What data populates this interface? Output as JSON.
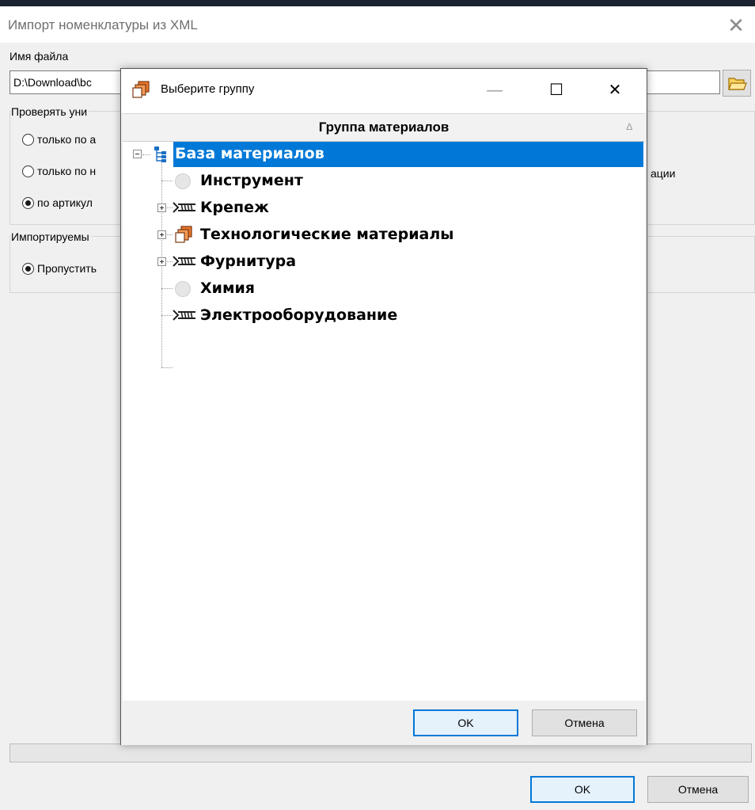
{
  "main": {
    "title": "Импорт номенклатуры из XML",
    "filename_label": "Имя файла",
    "filename_value": "D:\\Download\\bc",
    "check_group_label": "Проверять уни",
    "radio_options": [
      {
        "label": "только по а",
        "checked": false
      },
      {
        "label": "только по н",
        "checked": false
      },
      {
        "label": "по артикул",
        "checked": true
      }
    ],
    "right_fragment": "ации",
    "import_group_label": "Импортируемы",
    "skip_option": {
      "label": "Пропустить",
      "checked": true
    },
    "ok_label": "OK",
    "cancel_label": "Отмена"
  },
  "dialog": {
    "title": "Выберите группу",
    "column_header": "Группа материалов",
    "sort_indicator": "∆",
    "tree": [
      {
        "label": "База материалов",
        "icon": "hierarchy-icon",
        "selected": true,
        "expanded": true
      },
      {
        "label": "Инструмент",
        "icon": "circle-icon",
        "has_children": false
      },
      {
        "label": "Крепеж",
        "icon": "fastener-icon",
        "has_children": true
      },
      {
        "label": "Технологические материалы",
        "icon": "stack-icon",
        "has_children": true
      },
      {
        "label": "Фурнитура",
        "icon": "fastener-icon",
        "has_children": true
      },
      {
        "label": "Химия",
        "icon": "circle-icon",
        "has_children": false
      },
      {
        "label": "Электрооборудование",
        "icon": "fastener-icon",
        "has_children": false
      }
    ],
    "ok_label": "OK",
    "cancel_label": "Отмена"
  },
  "colors": {
    "selection": "#0078d7",
    "stack_icon_orange": "#e8752a"
  }
}
